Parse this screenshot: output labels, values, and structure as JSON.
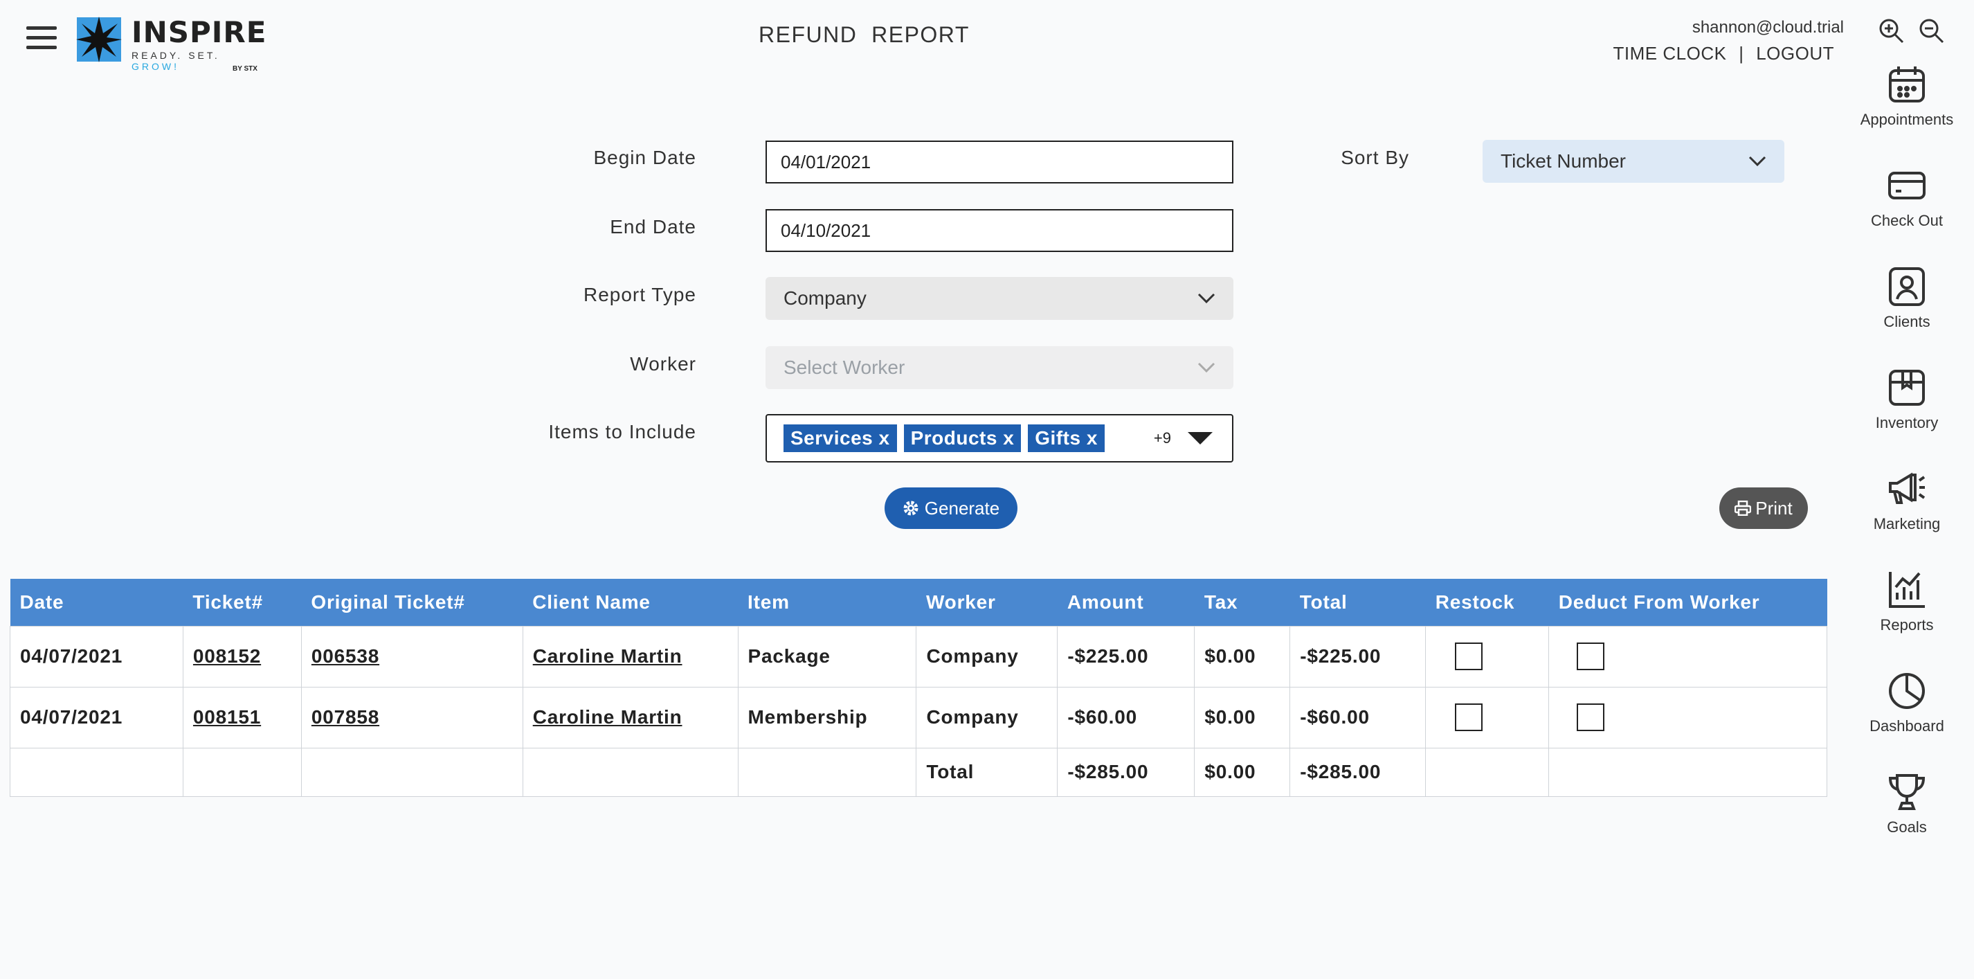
{
  "header": {
    "logo_title": "INSPIRE",
    "logo_tag_a": "READY. SET. ",
    "logo_tag_b": "GROW!",
    "logo_by": "BY STX",
    "page_title": "REFUND  REPORT",
    "user_email": "shannon@cloud.trial",
    "time_clock": "TIME CLOCK",
    "separator": "|",
    "logout": "LOGOUT"
  },
  "sidebar": {
    "items": [
      {
        "label": "Appointments",
        "icon": "calendar-icon"
      },
      {
        "label": "Check Out",
        "icon": "credit-card-icon"
      },
      {
        "label": "Clients",
        "icon": "client-icon"
      },
      {
        "label": "Inventory",
        "icon": "box-icon"
      },
      {
        "label": "Marketing",
        "icon": "megaphone-icon"
      },
      {
        "label": "Reports",
        "icon": "chart-icon"
      },
      {
        "label": "Dashboard",
        "icon": "pie-chart-icon"
      },
      {
        "label": "Goals",
        "icon": "trophy-icon"
      }
    ]
  },
  "form": {
    "begin_date_label": "Begin Date",
    "begin_date_value": "04/01/2021",
    "end_date_label": "End Date",
    "end_date_value": "04/10/2021",
    "report_type_label": "Report Type",
    "report_type_value": "Company",
    "worker_label": "Worker",
    "worker_placeholder": "Select Worker",
    "items_label": "Items to Include",
    "items_chips": [
      "Services x",
      "Products x",
      "Gifts x"
    ],
    "items_more": "+9",
    "sort_by_label": "Sort By",
    "sort_by_value": "Ticket Number",
    "generate_label": "Generate",
    "print_label": "Print"
  },
  "table": {
    "headers": [
      "Date",
      "Ticket#",
      "Original Ticket#",
      "Client Name",
      "Item",
      "Worker",
      "Amount",
      "Tax",
      "Total",
      "Restock",
      "Deduct From Worker"
    ],
    "rows": [
      {
        "date": "04/07/2021",
        "ticket": "008152",
        "original": "006538",
        "client": "Caroline Martin",
        "item": "Package",
        "worker": "Company",
        "amount": "-$225.00",
        "tax": "$0.00",
        "total": "-$225.00"
      },
      {
        "date": "04/07/2021",
        "ticket": "008151",
        "original": "007858",
        "client": "Caroline Martin",
        "item": "Membership",
        "worker": "Company",
        "amount": "-$60.00",
        "tax": "$0.00",
        "total": "-$60.00"
      }
    ],
    "totals": {
      "label": "Total",
      "amount": "-$285.00",
      "tax": "$0.00",
      "total": "-$285.00"
    }
  },
  "colors": {
    "accent": "#1f5fb0",
    "table_header": "#4a88d0",
    "print_button": "#555555"
  }
}
